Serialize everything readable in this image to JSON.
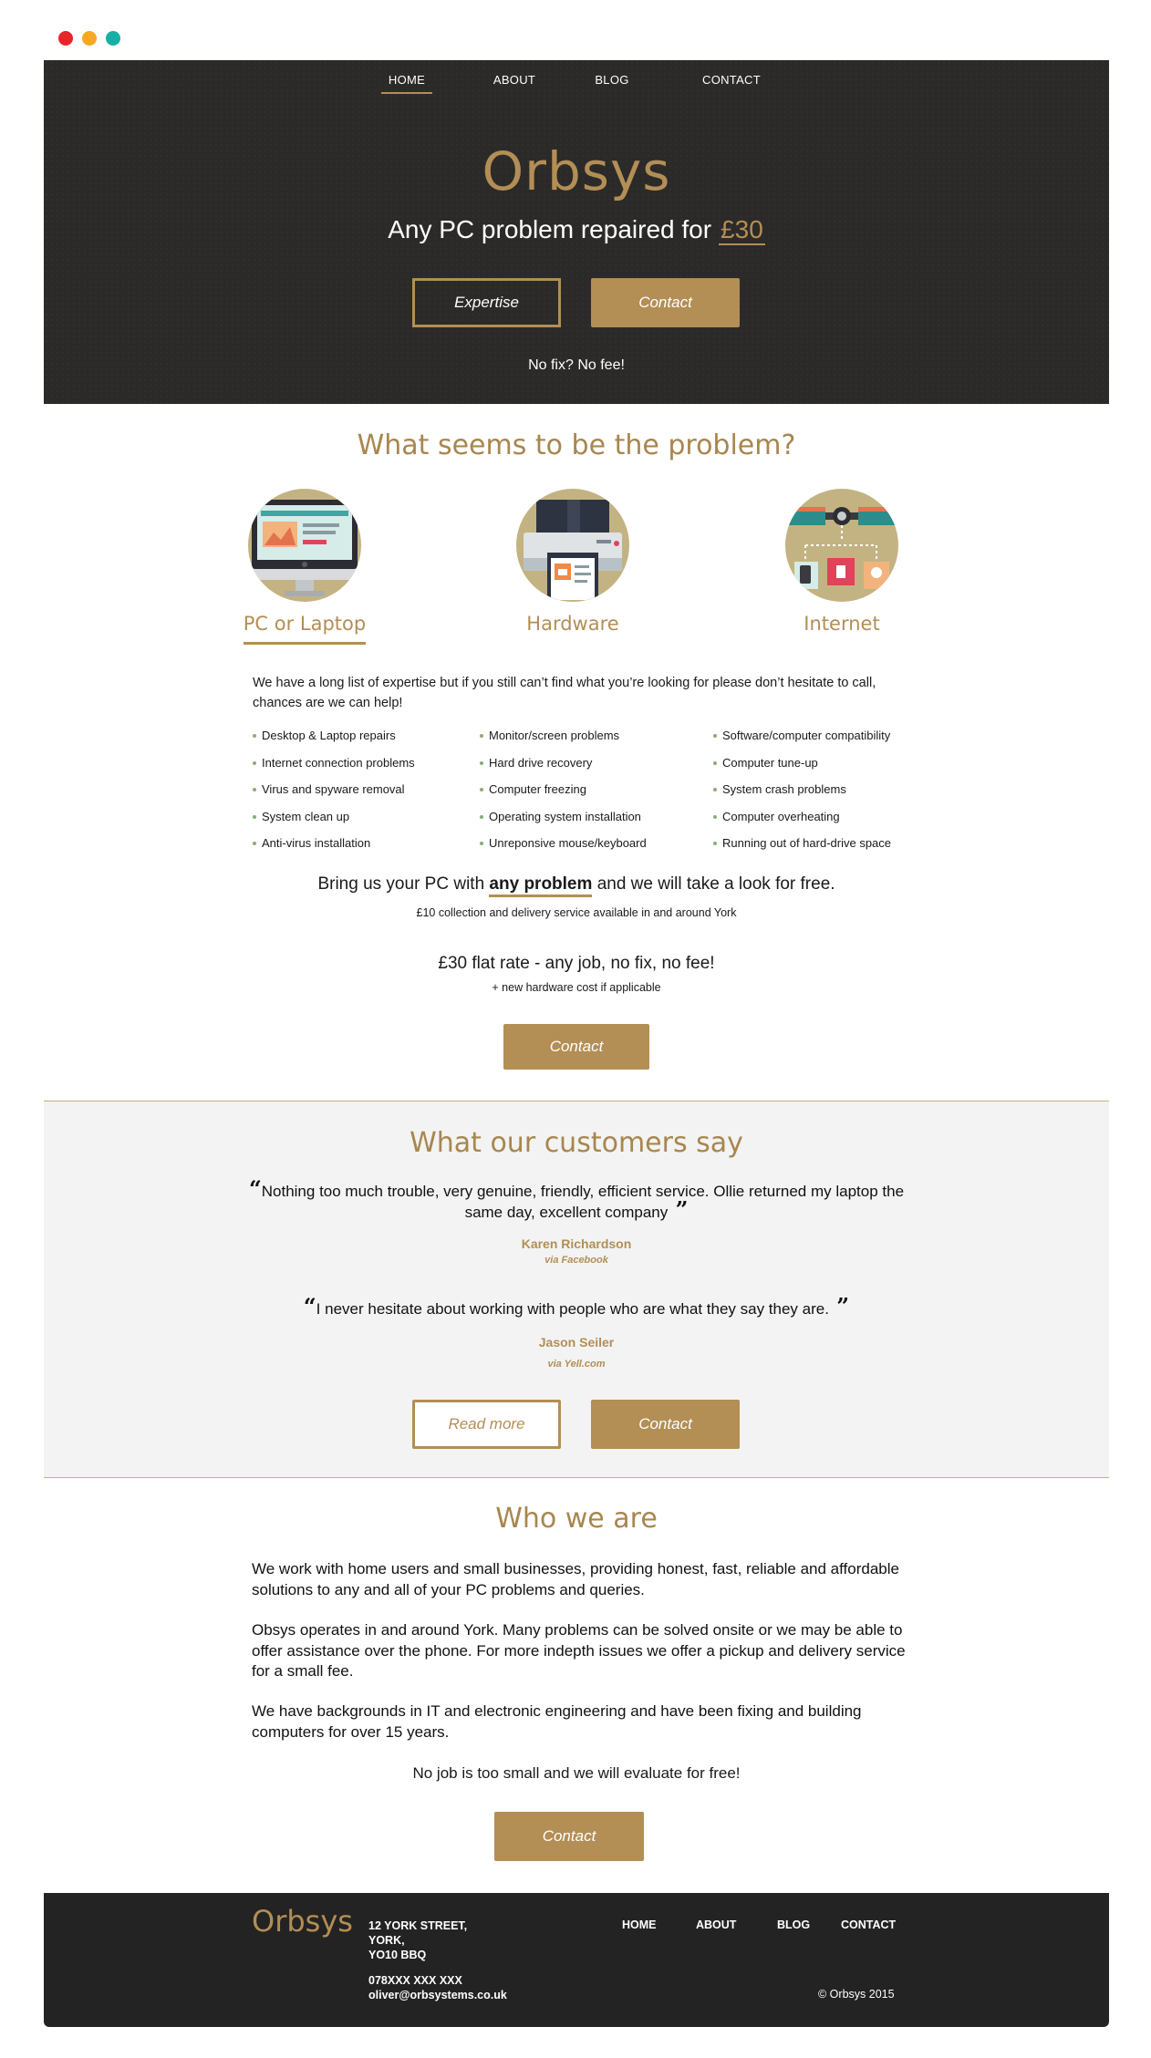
{
  "window": {
    "dots": [
      {
        "name": "close",
        "color": "#e8252a"
      },
      {
        "name": "minimize",
        "color": "#f7a823"
      },
      {
        "name": "maximize",
        "color": "#17b0a6"
      }
    ]
  },
  "nav": {
    "items": [
      "HOME",
      "ABOUT",
      "BLOG",
      "CONTACT"
    ],
    "active": "HOME"
  },
  "hero": {
    "brand": "Orbsys",
    "tagline": "Any PC problem repaired for",
    "price": "£30",
    "expertise_button": "Expertise",
    "contact_button": "Contact",
    "note": "No fix? No fee!"
  },
  "problems": {
    "title": "What seems to be the problem?",
    "categories": [
      {
        "label": "PC or Laptop",
        "icon": "computer-monitor-icon",
        "active": true
      },
      {
        "label": "Hardware",
        "icon": "printer-icon",
        "active": false
      },
      {
        "label": "Internet",
        "icon": "satellite-network-icon",
        "active": false
      }
    ],
    "intro": "We have a long list of expertise but if you still can’t find what you’re looking for please don’t hesitate to call, chances are we can help!",
    "columns": [
      [
        "Desktop & Laptop repairs",
        "Internet connection problems",
        "Virus and spyware removal",
        "System clean up",
        "Anti-virus installation"
      ],
      [
        "Monitor/screen problems",
        "Hard drive recovery",
        "Computer freezing",
        "Operating system installation",
        "Unreponsive mouse/keyboard"
      ],
      [
        "Software/computer compatibility",
        "Computer tune-up",
        "System crash problems",
        "Computer overheating",
        "Running out of hard-drive space"
      ]
    ],
    "bring_before": "Bring us your PC with",
    "bring_emphasis": "any problem",
    "bring_after": "and we will take a look for free.",
    "collection": "£10 collection and delivery service available in and around York",
    "flat_rate": "£30 flat rate - any job, no fix, no fee!",
    "hardware_cost": "+ new hardware cost if applicable",
    "contact_button": "Contact"
  },
  "testimonials": {
    "title": "What our customers say",
    "items": [
      {
        "quote": "Nothing too much trouble, very genuine, friendly, efficient service. Ollie returned my laptop the same day, excellent company",
        "author": "Karen Richardson",
        "via": "via Facebook"
      },
      {
        "quote": "I never hesitate about working with people who are what they say they are.",
        "author": "Jason Seiler",
        "via": "via Yell.com"
      }
    ],
    "read_more_button": "Read more",
    "contact_button": "Contact"
  },
  "about": {
    "title": "Who we are",
    "paragraphs": [
      "We work with home users and small businesses, providing honest, fast, reliable and affordable solutions to any and all of your PC problems and queries.",
      "Obsys operates in and around York. Many problems can be solved onsite or we may be able to offer assistance over the phone. For more indepth issues we offer a pickup and delivery service for a small fee.",
      "We have backgrounds in IT and electronic engineering and have been fixing and building computers for over 15 years."
    ],
    "closing": "No job is too small and we will evaluate for free!",
    "contact_button": "Contact"
  },
  "footer": {
    "brand": "Orbsys",
    "address": [
      "12 YORK STREET,",
      "YORK,",
      "YO10 BBQ"
    ],
    "phone": "078XXX XXX XXX",
    "email": "oliver@orbsystems.co.uk",
    "nav": [
      "HOME",
      "ABOUT",
      "BLOG",
      "CONTACT"
    ],
    "copyright": "© Orbsys 2015"
  },
  "colors": {
    "accent": "#b38e55",
    "hero_bg": "#2b2a29",
    "footer_bg": "#232323",
    "testimonial_bg": "#f3f3f3"
  }
}
